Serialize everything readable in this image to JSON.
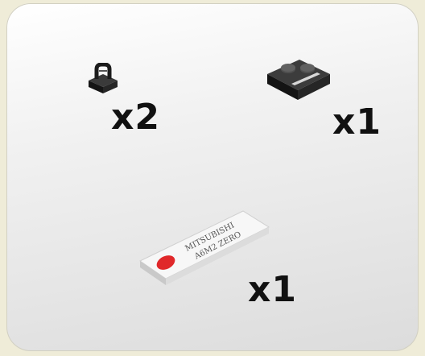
{
  "parts": [
    {
      "name": "clip",
      "icon": "clip-brick-icon",
      "quantity": "x2",
      "color": "#1a1a1a"
    },
    {
      "name": "plate",
      "icon": "plate-with-handle-icon",
      "quantity": "x1",
      "color": "#2a2a2a"
    },
    {
      "name": "printed-tile",
      "icon": "printed-tile-icon",
      "quantity": "x1",
      "color": "#f4f4f4",
      "accent_color": "#e0282a",
      "print_line_1": "MITSUBISHI",
      "print_line_2": "A6M2 ZERO"
    }
  ]
}
